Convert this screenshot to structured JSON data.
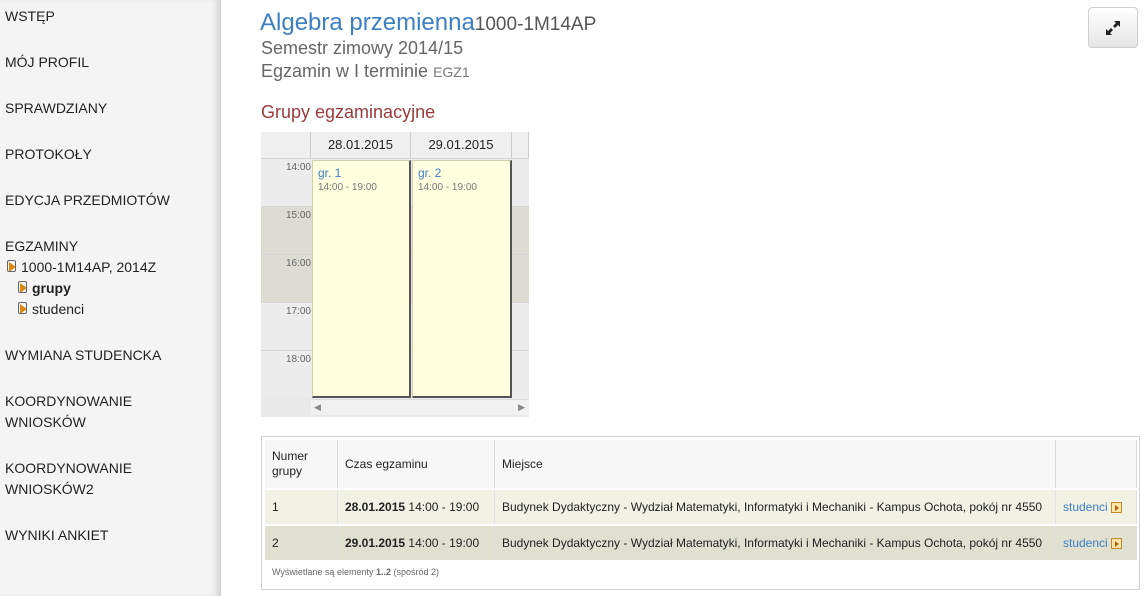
{
  "sidebar": {
    "items": [
      {
        "label": "WSTĘP"
      },
      {
        "label": "MÓJ PROFIL"
      },
      {
        "label": "SPRAWDZIANY"
      },
      {
        "label": "PROTOKOŁY"
      },
      {
        "label": "EDYCJA PRZEDMIOTÓW"
      },
      {
        "label": "EGZAMINY"
      },
      {
        "label": "WYMIANA STUDENCKA"
      },
      {
        "label": "KOORDYNOWANIE",
        "label2": "WNIOSKÓW"
      },
      {
        "label": "KOORDYNOWANIE",
        "label2": "WNIOSKÓW2"
      },
      {
        "label": "WYNIKI ANKIET"
      }
    ],
    "exam_sub": {
      "course": "1000-1M14AP, 2014Z",
      "groups": "grupy",
      "students": "studenci"
    }
  },
  "header": {
    "title": "Algebra przemienna",
    "code": "1000-1M14AP",
    "semester": "Semestr zimowy 2014/15",
    "exam": "Egzamin w I terminie",
    "exam_code": "EGZ1",
    "section_title": "Grupy egzaminacyjne"
  },
  "calendar": {
    "days": [
      "28.01.2015",
      "29.01.2015"
    ],
    "hours": [
      "14:00",
      "15:00",
      "16:00",
      "17:00",
      "18:00"
    ],
    "events": [
      {
        "title": "gr. 1",
        "time": "14:00 - 19:00"
      },
      {
        "title": "gr. 2",
        "time": "14:00 - 19:00"
      }
    ]
  },
  "table": {
    "headers": {
      "group_line1": "Numer",
      "group_line2": "grupy",
      "time": "Czas egzaminu",
      "place": "Miejsce"
    },
    "rows": [
      {
        "group": "1",
        "date": "28.01.2015",
        "time": "14:00 - 19:00",
        "place": "Budynek Dydaktyczny - Wydział Matematyki, Informatyki i Mechaniki - Kampus Ochota, pokój nr 4550",
        "link": "studenci"
      },
      {
        "group": "2",
        "date": "29.01.2015",
        "time": "14:00 - 19:00",
        "place": "Budynek Dydaktyczny - Wydział Matematyki, Informatyki i Mechaniki - Kampus Ochota, pokój nr 4550",
        "link": "studenci"
      }
    ],
    "footer_prefix": "Wyświetlane są elementy",
    "footer_range": "1..2",
    "footer_suffix": "(spośród 2)"
  }
}
